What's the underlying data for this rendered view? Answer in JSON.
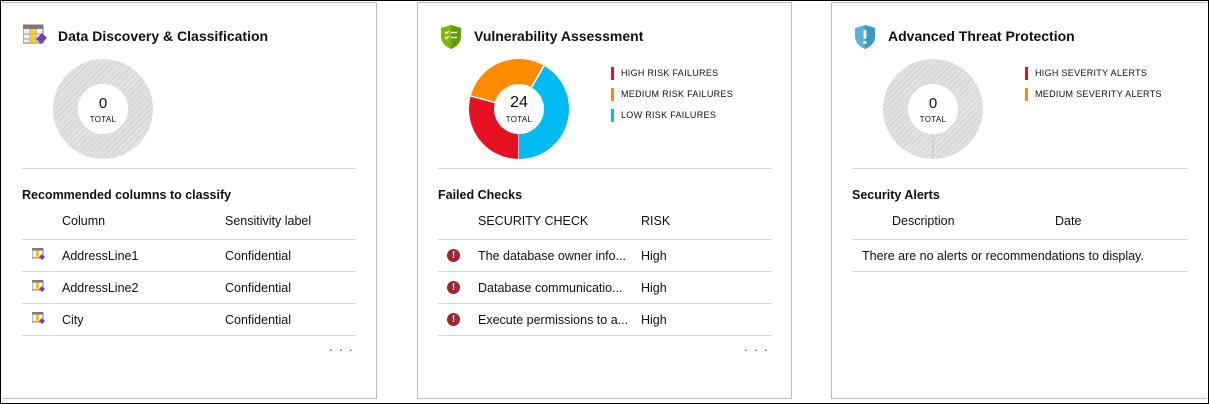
{
  "cards": {
    "discovery": {
      "title": "Data Discovery & Classification",
      "icon": "table-tag-icon",
      "donut": {
        "value": "0",
        "caption": "TOTAL"
      },
      "section_title": "Recommended columns to classify",
      "columns": [
        "Column",
        "Sensitivity label"
      ],
      "rows": [
        {
          "column": "AddressLine1",
          "label": "Confidential"
        },
        {
          "column": "AddressLine2",
          "label": "Confidential"
        },
        {
          "column": "City",
          "label": "Confidential"
        }
      ],
      "more": "· · ·"
    },
    "vulnerability": {
      "title": "Vulnerability Assessment",
      "icon": "shield-check-icon",
      "donut": {
        "value": "24",
        "caption": "TOTAL"
      },
      "legend": [
        {
          "label": "HIGH RISK FAILURES",
          "color": "#e81123"
        },
        {
          "label": "MEDIUM RISK FAILURES",
          "color": "#ff8c00"
        },
        {
          "label": "LOW RISK FAILURES",
          "color": "#00bcf2"
        }
      ],
      "section_title": "Failed Checks",
      "columns": [
        "SECURITY CHECK",
        "RISK"
      ],
      "rows": [
        {
          "check": "The database owner info...",
          "risk": "High"
        },
        {
          "check": "Database communicatio...",
          "risk": "High"
        },
        {
          "check": "Execute permissions to a...",
          "risk": "High"
        }
      ],
      "more": "· · ·"
    },
    "threat": {
      "title": "Advanced Threat Protection",
      "icon": "shield-alert-icon",
      "donut": {
        "value": "0",
        "caption": "TOTAL"
      },
      "legend": [
        {
          "label": "HIGH SEVERITY ALERTS",
          "color": "#e81123"
        },
        {
          "label": "MEDIUM SEVERITY ALERTS",
          "color": "#ff8c00"
        }
      ],
      "section_title": "Security Alerts",
      "columns": [
        "Description",
        "Date"
      ],
      "empty_message": "There are no alerts or recommendations to display."
    }
  },
  "chart_data": [
    {
      "type": "pie",
      "categories": [
        "HIGH RISK FAILURES",
        "MEDIUM RISK FAILURES",
        "LOW RISK FAILURES"
      ],
      "values": [
        7,
        7,
        10
      ],
      "total": 24
    }
  ]
}
